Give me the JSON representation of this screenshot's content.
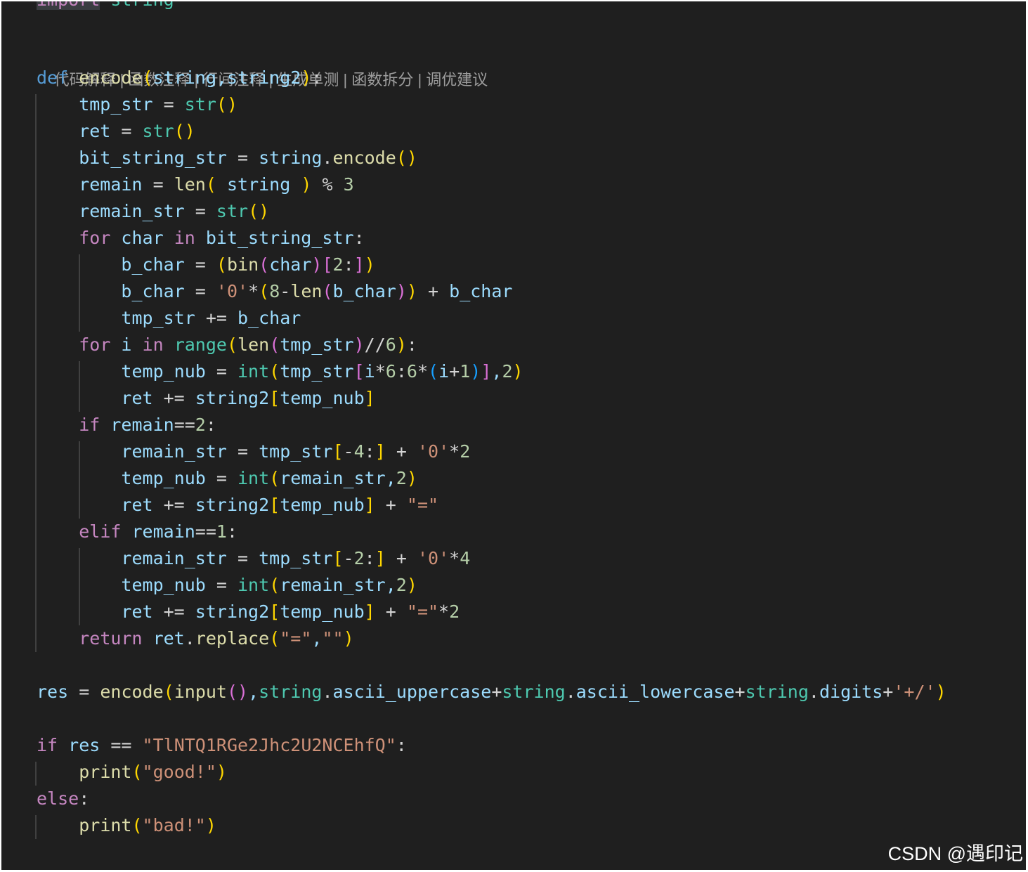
{
  "editor": {
    "codelens": [
      "代码解释",
      "函数注释",
      "行间注释",
      "生成单测",
      "函数拆分",
      "调优建议"
    ],
    "codelens_separator": " | ",
    "lines": [
      "import string",
      "def encode(string,string2):",
      "    tmp_str = str()",
      "    ret = str()",
      "    bit_string_str = string.encode()",
      "    remain = len( string ) % 3",
      "    remain_str = str()",
      "    for char in bit_string_str:",
      "        b_char = (bin(char)[2:])",
      "        b_char = '0'*(8-len(b_char)) + b_char",
      "        tmp_str += b_char",
      "    for i in range(len(tmp_str)//6):",
      "        temp_nub = int(tmp_str[i*6:6*(i+1)],2)",
      "        ret += string2[temp_nub]",
      "    if remain==2:",
      "        remain_str = tmp_str[-4:] + '0'*2",
      "        temp_nub = int(remain_str,2)",
      "        ret += string2[temp_nub] + \"=\"",
      "    elif remain==1:",
      "        remain_str = tmp_str[-2:] + '0'*4",
      "        temp_nub = int(remain_str,2)",
      "        ret += string2[temp_nub] + \"=\"*2",
      "    return ret.replace(\"=\",\"\")",
      "",
      "res = encode(input(),string.ascii_uppercase+string.ascii_lowercase+string.digits+'+/')",
      "",
      "if res == \"TlNTQ1RGe2Jhc2U2NCEhfQ\":",
      "    print(\"good!\")",
      "else:",
      "    print(\"bad!\")"
    ],
    "theme_colors": {
      "background": "#1f1f1f",
      "keyword": "#c586c0",
      "def": "#569cd6",
      "function": "#dcdcaa",
      "builtin": "#4ec9b0",
      "variable": "#9cdcfe",
      "number": "#b5cea8",
      "string": "#ce9178",
      "bracket1": "#ffd700",
      "bracket2": "#da70d6",
      "bracket3": "#179fff"
    }
  },
  "watermark": "CSDN @遇印记"
}
